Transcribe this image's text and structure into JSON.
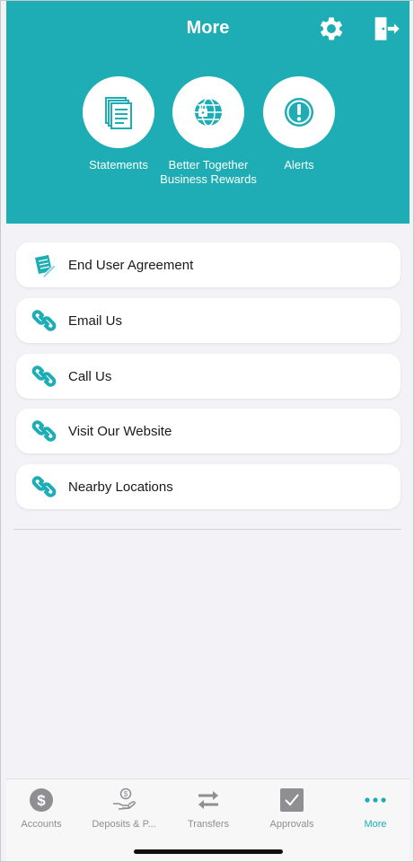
{
  "header": {
    "title": "More",
    "icons": [
      "gear-icon",
      "sign-out-icon"
    ]
  },
  "quick_actions": [
    {
      "label": "Statements",
      "icon": "documents-icon"
    },
    {
      "label": "Better Together Business Rewards",
      "icon": "globe-lock-icon"
    },
    {
      "label": "Alerts",
      "icon": "alert-icon"
    }
  ],
  "menu": [
    {
      "label": "End User Agreement",
      "icon": "agreement-icon"
    },
    {
      "label": "Email Us",
      "icon": "link-icon"
    },
    {
      "label": "Call Us",
      "icon": "link-icon"
    },
    {
      "label": "Visit Our Website",
      "icon": "link-icon"
    },
    {
      "label": "Nearby Locations",
      "icon": "link-icon"
    }
  ],
  "tabbar": {
    "tabs": [
      {
        "label": "Accounts",
        "icon": "dollar-icon"
      },
      {
        "label": "Deposits & P...",
        "icon": "deposit-icon"
      },
      {
        "label": "Transfers",
        "icon": "transfer-arrows-icon"
      },
      {
        "label": "Approvals",
        "icon": "checkbox-icon"
      },
      {
        "label": "More",
        "icon": "more-dots-icon"
      }
    ],
    "active": "More"
  },
  "colors": {
    "brand": "#1eadb4",
    "background": "#f2f2f7",
    "tab_inactive": "#8e8e93"
  }
}
